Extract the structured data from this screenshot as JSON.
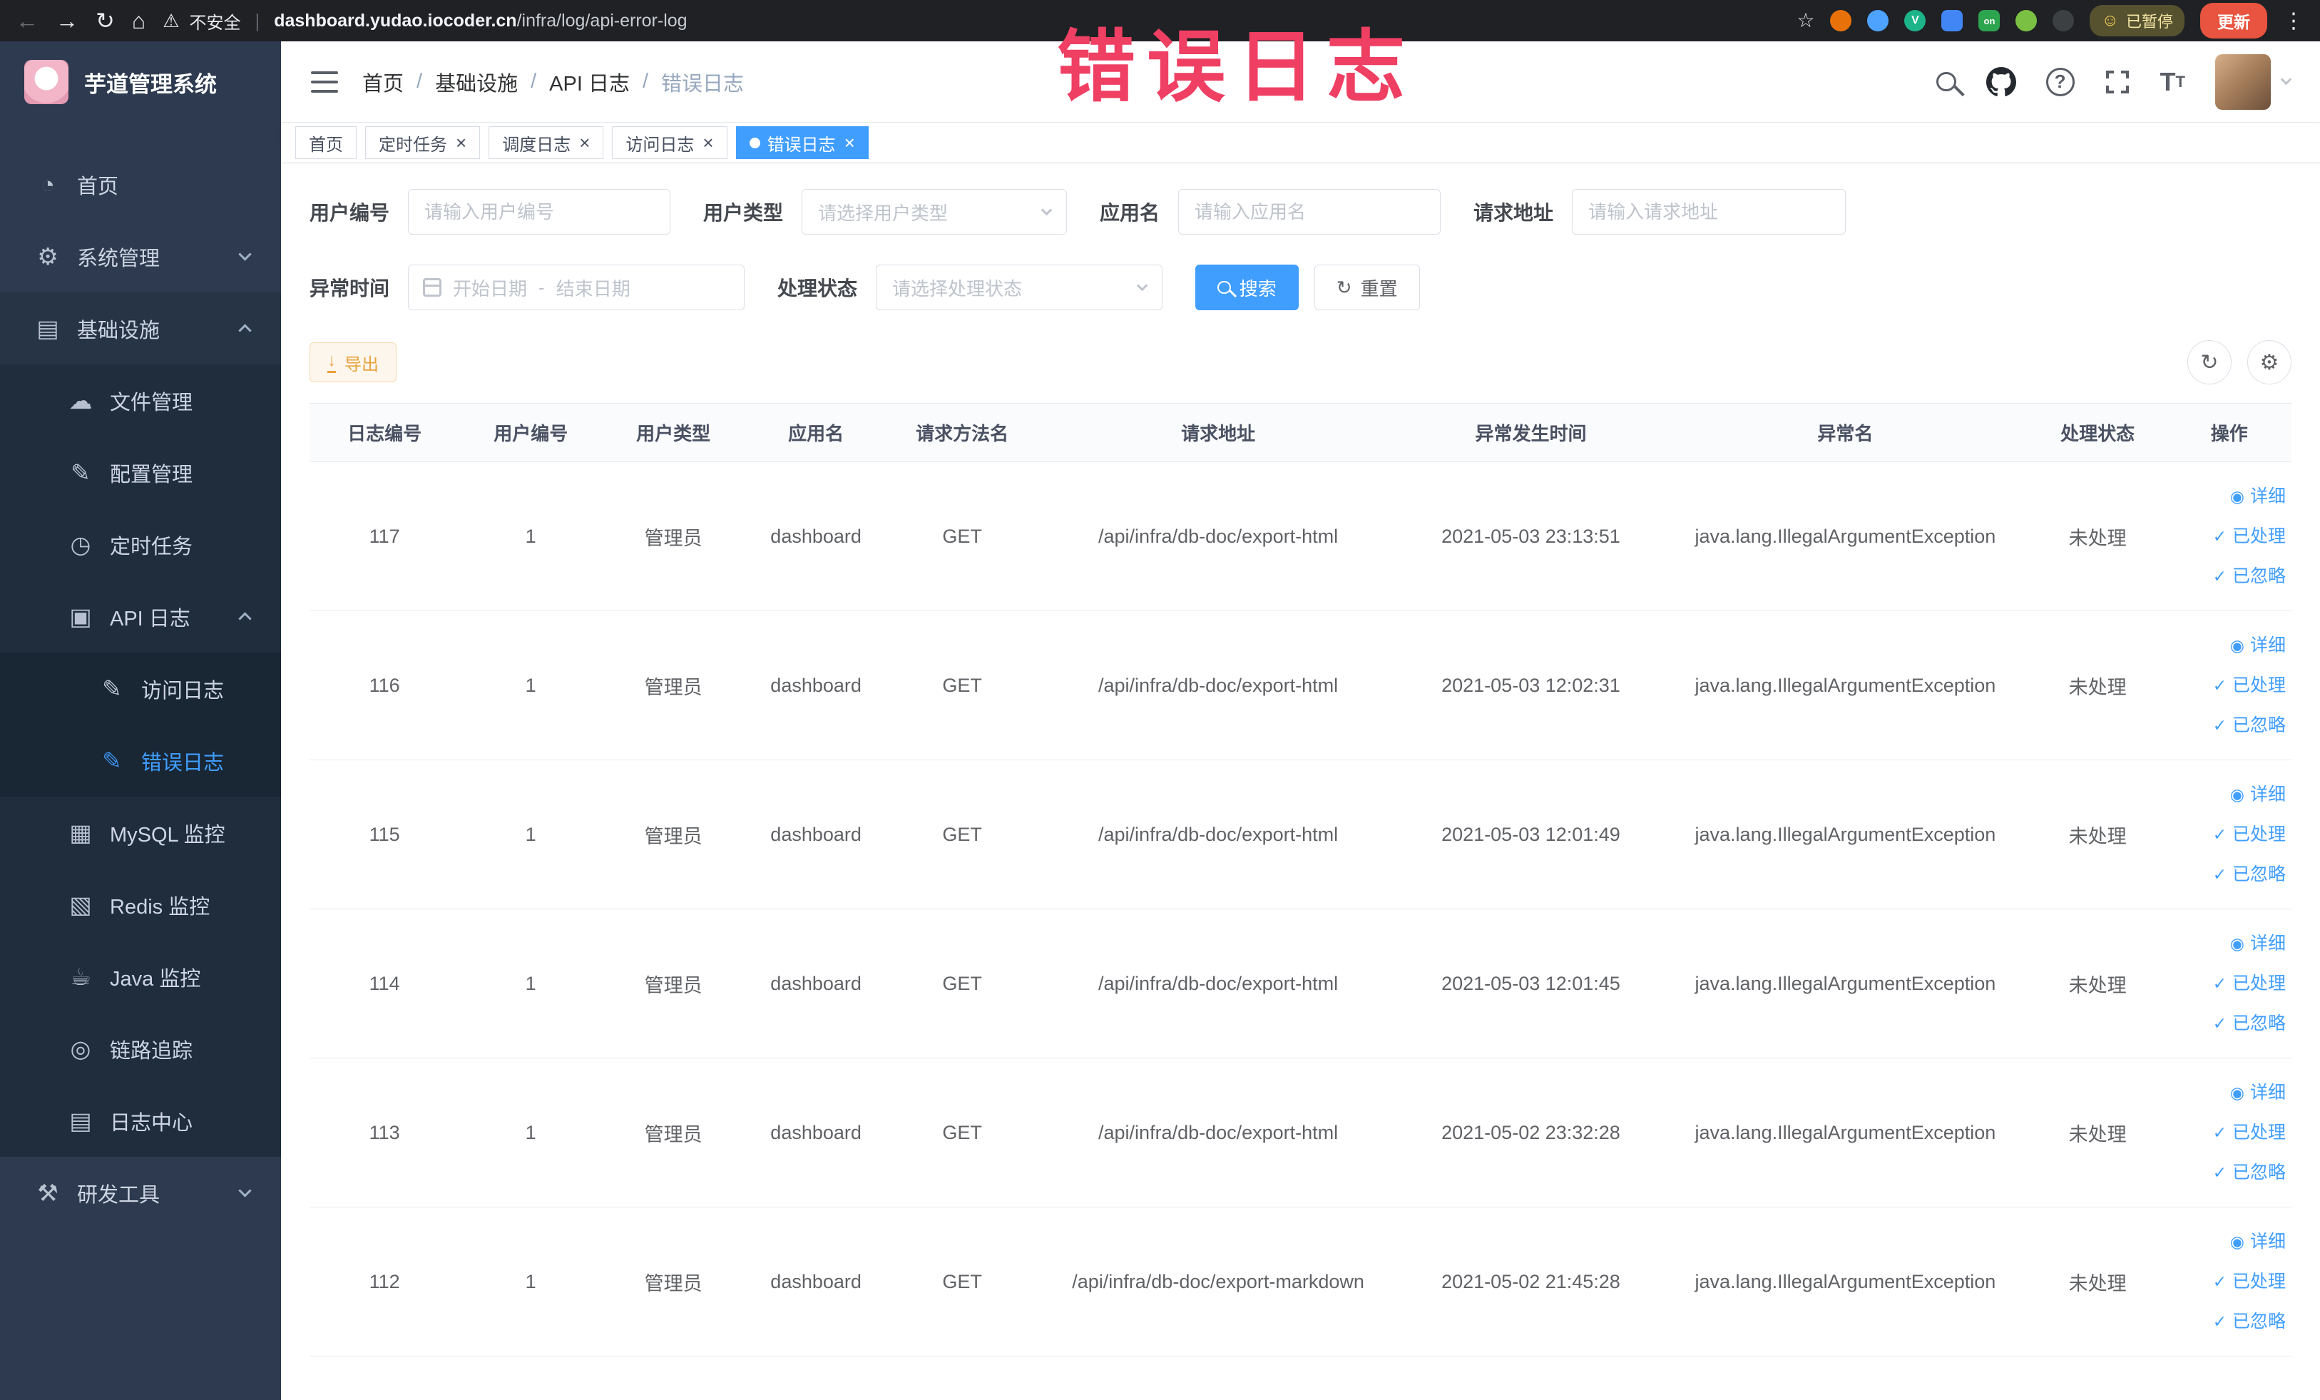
{
  "colors": {
    "accent": "#409eff",
    "warning": "#e6a23c",
    "annotation": "#ef3f63",
    "sidebar_bg": "#2d3a4f"
  },
  "browser": {
    "security_label": "不安全",
    "url_domain": "dashboard.yudao.iocoder.cn",
    "url_path": "/infra/log/api-error-log",
    "ext_on_label": "on",
    "paused_label": "已暂停",
    "update_label": "更新"
  },
  "annotation": {
    "text": "错误日志"
  },
  "sidebar": {
    "title": "芋道管理系统",
    "items": [
      {
        "key": "home",
        "label": "首页",
        "icon": "dashboard-icon",
        "level": 1
      },
      {
        "key": "system",
        "label": "系统管理",
        "icon": "gear-icon",
        "level": 1,
        "arrow": "down"
      },
      {
        "key": "infra",
        "label": "基础设施",
        "icon": "infra-icon",
        "level": 1,
        "arrow": "up",
        "open": true
      },
      {
        "key": "file",
        "label": "文件管理",
        "icon": "file-icon",
        "level": 2
      },
      {
        "key": "config",
        "label": "配置管理",
        "icon": "config-icon",
        "level": 2
      },
      {
        "key": "job",
        "label": "定时任务",
        "icon": "job-icon",
        "level": 2
      },
      {
        "key": "api-log",
        "label": "API 日志",
        "icon": "api-log-icon",
        "level": 2,
        "arrow": "up",
        "open": true
      },
      {
        "key": "access-log",
        "label": "访问日志",
        "icon": "access-log-icon",
        "level": 3
      },
      {
        "key": "error-log",
        "label": "错误日志",
        "icon": "error-log-icon",
        "level": 3,
        "active": true
      },
      {
        "key": "mysql",
        "label": "MySQL 监控",
        "icon": "mysql-icon",
        "level": 2
      },
      {
        "key": "redis",
        "label": "Redis 监控",
        "icon": "redis-icon",
        "level": 2
      },
      {
        "key": "java",
        "label": "Java 监控",
        "icon": "java-icon",
        "level": 2
      },
      {
        "key": "trace",
        "label": "链路追踪",
        "icon": "trace-icon",
        "level": 2
      },
      {
        "key": "log-center",
        "label": "日志中心",
        "icon": "log-center-icon",
        "level": 2
      },
      {
        "key": "dev-tools",
        "label": "研发工具",
        "icon": "tools-icon",
        "level": 1,
        "arrow": "down"
      }
    ]
  },
  "navbar": {
    "breadcrumb": [
      "首页",
      "基础设施",
      "API 日志",
      "错误日志"
    ]
  },
  "tabs": [
    {
      "label": "首页",
      "closable": false,
      "active": false
    },
    {
      "label": "定时任务",
      "closable": true,
      "active": false
    },
    {
      "label": "调度日志",
      "closable": true,
      "active": false
    },
    {
      "label": "访问日志",
      "closable": true,
      "active": false
    },
    {
      "label": "错误日志",
      "closable": true,
      "active": true
    }
  ],
  "filters": {
    "user_id_label": "用户编号",
    "user_id_placeholder": "请输入用户编号",
    "user_type_label": "用户类型",
    "user_type_placeholder": "请选择用户类型",
    "app_name_label": "应用名",
    "app_name_placeholder": "请输入应用名",
    "request_url_label": "请求地址",
    "request_url_placeholder": "请输入请求地址",
    "exception_time_label": "异常时间",
    "start_placeholder": "开始日期",
    "end_placeholder": "结束日期",
    "range_separator": "-",
    "process_status_label": "处理状态",
    "process_status_placeholder": "请选择处理状态",
    "search_label": "搜索",
    "reset_label": "重置"
  },
  "toolbar": {
    "export_label": "导出"
  },
  "table": {
    "columns": [
      "日志编号",
      "用户编号",
      "用户类型",
      "应用名",
      "请求方法名",
      "请求地址",
      "异常发生时间",
      "异常名",
      "处理状态",
      "操作"
    ],
    "action_labels": [
      "详细",
      "已处理",
      "已忽略"
    ],
    "rows": [
      {
        "log_id": "117",
        "user_id": "1",
        "user_type": "管理员",
        "app_name": "dashboard",
        "method": "GET",
        "request_url": "/api/infra/db-doc/export-html",
        "time": "2021-05-03 23:13:51",
        "exception": "java.lang.IllegalArgumentException",
        "status": "未处理"
      },
      {
        "log_id": "116",
        "user_id": "1",
        "user_type": "管理员",
        "app_name": "dashboard",
        "method": "GET",
        "request_url": "/api/infra/db-doc/export-html",
        "time": "2021-05-03 12:02:31",
        "exception": "java.lang.IllegalArgumentException",
        "status": "未处理"
      },
      {
        "log_id": "115",
        "user_id": "1",
        "user_type": "管理员",
        "app_name": "dashboard",
        "method": "GET",
        "request_url": "/api/infra/db-doc/export-html",
        "time": "2021-05-03 12:01:49",
        "exception": "java.lang.IllegalArgumentException",
        "status": "未处理"
      },
      {
        "log_id": "114",
        "user_id": "1",
        "user_type": "管理员",
        "app_name": "dashboard",
        "method": "GET",
        "request_url": "/api/infra/db-doc/export-html",
        "time": "2021-05-03 12:01:45",
        "exception": "java.lang.IllegalArgumentException",
        "status": "未处理"
      },
      {
        "log_id": "113",
        "user_id": "1",
        "user_type": "管理员",
        "app_name": "dashboard",
        "method": "GET",
        "request_url": "/api/infra/db-doc/export-html",
        "time": "2021-05-02 23:32:28",
        "exception": "java.lang.IllegalArgumentException",
        "status": "未处理"
      },
      {
        "log_id": "112",
        "user_id": "1",
        "user_type": "管理员",
        "app_name": "dashboard",
        "method": "GET",
        "request_url": "/api/infra/db-doc/export-markdown",
        "time": "2021-05-02 21:45:28",
        "exception": "java.lang.IllegalArgumentException",
        "status": "未处理"
      }
    ]
  }
}
